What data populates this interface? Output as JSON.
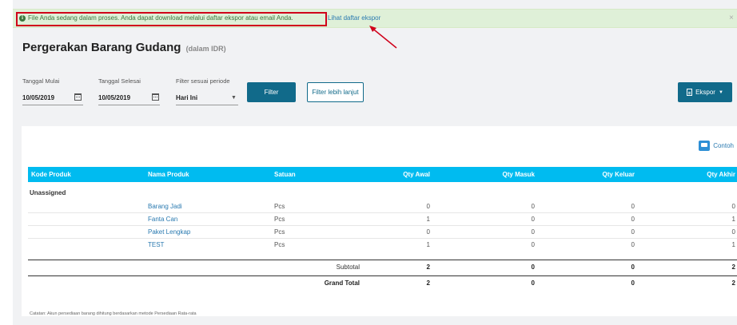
{
  "alert": {
    "message": "File Anda sedang dalam proses. Anda dapat download melalui daftar ekspor atau email Anda.",
    "link": "Lihat daftar ekspor",
    "close": "×",
    "icon": "info-icon"
  },
  "header": {
    "title": "Pergerakan Barang Gudang",
    "subtitle": "(dalam IDR)"
  },
  "filters": {
    "start_label": "Tanggal Mulai",
    "start_value": "10/05/2019",
    "end_label": "Tanggal Selesai",
    "end_value": "10/05/2019",
    "period_label": "Filter sesuai periode",
    "period_value": "Hari Ini",
    "filter_button": "Filter",
    "more_button": "Filter lebih lanjut",
    "export_button": "Ekspor"
  },
  "report": {
    "contoh": "Contoh",
    "columns": [
      "Kode Produk",
      "Nama Produk",
      "Satuan",
      "Qty Awal",
      "Qty Masuk",
      "Qty Keluar",
      "Qty Akhir"
    ],
    "group": "Unassigned",
    "rows": [
      {
        "name": "Barang Jadi",
        "unit": "Pcs",
        "awal": "0",
        "masuk": "0",
        "keluar": "0",
        "akhir": "0"
      },
      {
        "name": "Fanta Can",
        "unit": "Pcs",
        "awal": "1",
        "masuk": "0",
        "keluar": "0",
        "akhir": "1"
      },
      {
        "name": "Paket Lengkap",
        "unit": "Pcs",
        "awal": "0",
        "masuk": "0",
        "keluar": "0",
        "akhir": "0"
      },
      {
        "name": "TEST",
        "unit": "Pcs",
        "awal": "1",
        "masuk": "0",
        "keluar": "0",
        "akhir": "1"
      }
    ],
    "subtotal": {
      "label": "Subtotal",
      "awal": "2",
      "masuk": "0",
      "keluar": "0",
      "akhir": "2"
    },
    "grand_total": {
      "label": "Grand Total",
      "awal": "2",
      "masuk": "0",
      "keluar": "0",
      "akhir": "2"
    },
    "note": "Catatan: Akun persediaan barang dihitung berdasarkan metode Persediaan Rata-rata"
  },
  "colors": {
    "alert_bg": "#dff0d8",
    "highlight": "#d0021b",
    "primary": "#116a8a",
    "table_header": "#00bbf0",
    "link": "#2a7ab0"
  }
}
